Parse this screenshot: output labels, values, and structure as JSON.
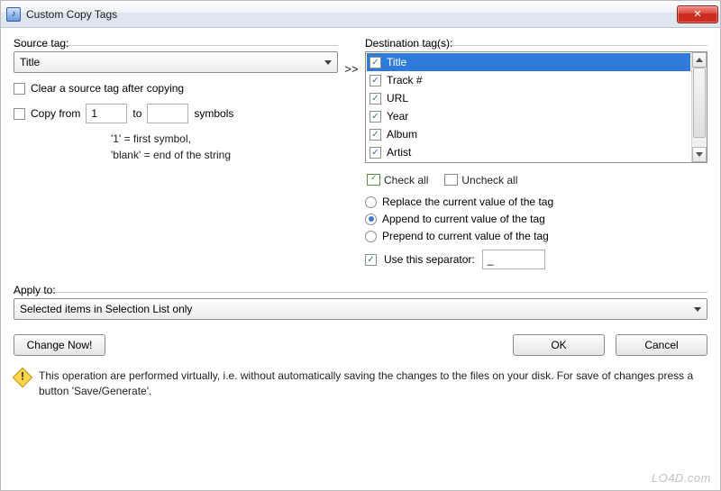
{
  "window": {
    "title": "Custom Copy Tags"
  },
  "source": {
    "label": "Source tag:",
    "selected": "Title",
    "clear_label": "Clear a source tag after copying",
    "clear_checked": false,
    "copy_from_label": "Copy from",
    "copy_from_checked": false,
    "copy_from_value": "1",
    "copy_to_label": "to",
    "copy_to_value": "",
    "symbols_label": "symbols",
    "hint1": "'1' = first symbol,",
    "hint2": "'blank' = end of the string"
  },
  "arrow": ">>",
  "dest": {
    "label": "Destination tag(s):",
    "items": [
      {
        "label": "Title",
        "checked": true,
        "selected": true
      },
      {
        "label": "Track #",
        "checked": true,
        "selected": false
      },
      {
        "label": "URL",
        "checked": true,
        "selected": false
      },
      {
        "label": "Year",
        "checked": true,
        "selected": false
      },
      {
        "label": "Album",
        "checked": true,
        "selected": false
      },
      {
        "label": "Artist",
        "checked": true,
        "selected": false
      }
    ],
    "check_all": "Check all",
    "uncheck_all": "Uncheck all",
    "mode": {
      "replace": "Replace the current value of the tag",
      "append": "Append to current value of the tag",
      "prepend": "Prepend to current value of the tag",
      "selected": "append"
    },
    "separator_label": "Use this separator:",
    "separator_checked": true,
    "separator_value": "_"
  },
  "apply": {
    "label": "Apply to:",
    "selected": "Selected items in Selection List only"
  },
  "buttons": {
    "change": "Change Now!",
    "ok": "OK",
    "cancel": "Cancel"
  },
  "warning": "This operation are performed virtually, i.e. without automatically saving the changes to the files on your disk. For save of changes press a button 'Save/Generate'.",
  "watermark": "LO4D.com"
}
